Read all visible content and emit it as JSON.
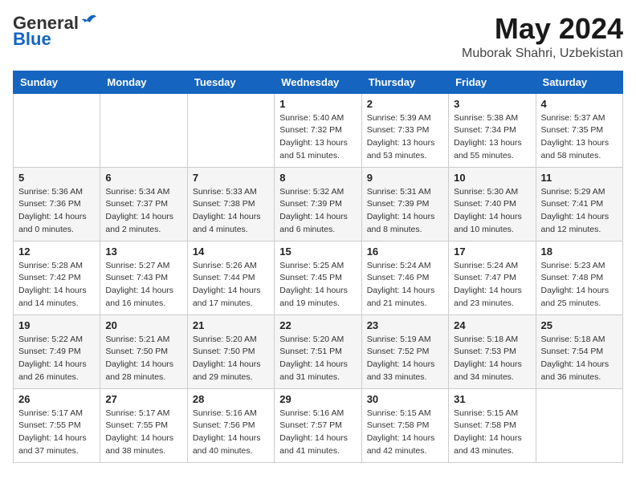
{
  "header": {
    "logo_general": "General",
    "logo_blue": "Blue",
    "month": "May 2024",
    "location": "Muborak Shahri, Uzbekistan"
  },
  "days_of_week": [
    "Sunday",
    "Monday",
    "Tuesday",
    "Wednesday",
    "Thursday",
    "Friday",
    "Saturday"
  ],
  "weeks": [
    [
      {
        "day": "",
        "sunrise": "",
        "sunset": "",
        "daylight": ""
      },
      {
        "day": "",
        "sunrise": "",
        "sunset": "",
        "daylight": ""
      },
      {
        "day": "",
        "sunrise": "",
        "sunset": "",
        "daylight": ""
      },
      {
        "day": "1",
        "sunrise": "Sunrise: 5:40 AM",
        "sunset": "Sunset: 7:32 PM",
        "daylight": "Daylight: 13 hours and 51 minutes."
      },
      {
        "day": "2",
        "sunrise": "Sunrise: 5:39 AM",
        "sunset": "Sunset: 7:33 PM",
        "daylight": "Daylight: 13 hours and 53 minutes."
      },
      {
        "day": "3",
        "sunrise": "Sunrise: 5:38 AM",
        "sunset": "Sunset: 7:34 PM",
        "daylight": "Daylight: 13 hours and 55 minutes."
      },
      {
        "day": "4",
        "sunrise": "Sunrise: 5:37 AM",
        "sunset": "Sunset: 7:35 PM",
        "daylight": "Daylight: 13 hours and 58 minutes."
      }
    ],
    [
      {
        "day": "5",
        "sunrise": "Sunrise: 5:36 AM",
        "sunset": "Sunset: 7:36 PM",
        "daylight": "Daylight: 14 hours and 0 minutes."
      },
      {
        "day": "6",
        "sunrise": "Sunrise: 5:34 AM",
        "sunset": "Sunset: 7:37 PM",
        "daylight": "Daylight: 14 hours and 2 minutes."
      },
      {
        "day": "7",
        "sunrise": "Sunrise: 5:33 AM",
        "sunset": "Sunset: 7:38 PM",
        "daylight": "Daylight: 14 hours and 4 minutes."
      },
      {
        "day": "8",
        "sunrise": "Sunrise: 5:32 AM",
        "sunset": "Sunset: 7:39 PM",
        "daylight": "Daylight: 14 hours and 6 minutes."
      },
      {
        "day": "9",
        "sunrise": "Sunrise: 5:31 AM",
        "sunset": "Sunset: 7:39 PM",
        "daylight": "Daylight: 14 hours and 8 minutes."
      },
      {
        "day": "10",
        "sunrise": "Sunrise: 5:30 AM",
        "sunset": "Sunset: 7:40 PM",
        "daylight": "Daylight: 14 hours and 10 minutes."
      },
      {
        "day": "11",
        "sunrise": "Sunrise: 5:29 AM",
        "sunset": "Sunset: 7:41 PM",
        "daylight": "Daylight: 14 hours and 12 minutes."
      }
    ],
    [
      {
        "day": "12",
        "sunrise": "Sunrise: 5:28 AM",
        "sunset": "Sunset: 7:42 PM",
        "daylight": "Daylight: 14 hours and 14 minutes."
      },
      {
        "day": "13",
        "sunrise": "Sunrise: 5:27 AM",
        "sunset": "Sunset: 7:43 PM",
        "daylight": "Daylight: 14 hours and 16 minutes."
      },
      {
        "day": "14",
        "sunrise": "Sunrise: 5:26 AM",
        "sunset": "Sunset: 7:44 PM",
        "daylight": "Daylight: 14 hours and 17 minutes."
      },
      {
        "day": "15",
        "sunrise": "Sunrise: 5:25 AM",
        "sunset": "Sunset: 7:45 PM",
        "daylight": "Daylight: 14 hours and 19 minutes."
      },
      {
        "day": "16",
        "sunrise": "Sunrise: 5:24 AM",
        "sunset": "Sunset: 7:46 PM",
        "daylight": "Daylight: 14 hours and 21 minutes."
      },
      {
        "day": "17",
        "sunrise": "Sunrise: 5:24 AM",
        "sunset": "Sunset: 7:47 PM",
        "daylight": "Daylight: 14 hours and 23 minutes."
      },
      {
        "day": "18",
        "sunrise": "Sunrise: 5:23 AM",
        "sunset": "Sunset: 7:48 PM",
        "daylight": "Daylight: 14 hours and 25 minutes."
      }
    ],
    [
      {
        "day": "19",
        "sunrise": "Sunrise: 5:22 AM",
        "sunset": "Sunset: 7:49 PM",
        "daylight": "Daylight: 14 hours and 26 minutes."
      },
      {
        "day": "20",
        "sunrise": "Sunrise: 5:21 AM",
        "sunset": "Sunset: 7:50 PM",
        "daylight": "Daylight: 14 hours and 28 minutes."
      },
      {
        "day": "21",
        "sunrise": "Sunrise: 5:20 AM",
        "sunset": "Sunset: 7:50 PM",
        "daylight": "Daylight: 14 hours and 29 minutes."
      },
      {
        "day": "22",
        "sunrise": "Sunrise: 5:20 AM",
        "sunset": "Sunset: 7:51 PM",
        "daylight": "Daylight: 14 hours and 31 minutes."
      },
      {
        "day": "23",
        "sunrise": "Sunrise: 5:19 AM",
        "sunset": "Sunset: 7:52 PM",
        "daylight": "Daylight: 14 hours and 33 minutes."
      },
      {
        "day": "24",
        "sunrise": "Sunrise: 5:18 AM",
        "sunset": "Sunset: 7:53 PM",
        "daylight": "Daylight: 14 hours and 34 minutes."
      },
      {
        "day": "25",
        "sunrise": "Sunrise: 5:18 AM",
        "sunset": "Sunset: 7:54 PM",
        "daylight": "Daylight: 14 hours and 36 minutes."
      }
    ],
    [
      {
        "day": "26",
        "sunrise": "Sunrise: 5:17 AM",
        "sunset": "Sunset: 7:55 PM",
        "daylight": "Daylight: 14 hours and 37 minutes."
      },
      {
        "day": "27",
        "sunrise": "Sunrise: 5:17 AM",
        "sunset": "Sunset: 7:55 PM",
        "daylight": "Daylight: 14 hours and 38 minutes."
      },
      {
        "day": "28",
        "sunrise": "Sunrise: 5:16 AM",
        "sunset": "Sunset: 7:56 PM",
        "daylight": "Daylight: 14 hours and 40 minutes."
      },
      {
        "day": "29",
        "sunrise": "Sunrise: 5:16 AM",
        "sunset": "Sunset: 7:57 PM",
        "daylight": "Daylight: 14 hours and 41 minutes."
      },
      {
        "day": "30",
        "sunrise": "Sunrise: 5:15 AM",
        "sunset": "Sunset: 7:58 PM",
        "daylight": "Daylight: 14 hours and 42 minutes."
      },
      {
        "day": "31",
        "sunrise": "Sunrise: 5:15 AM",
        "sunset": "Sunset: 7:58 PM",
        "daylight": "Daylight: 14 hours and 43 minutes."
      },
      {
        "day": "",
        "sunrise": "",
        "sunset": "",
        "daylight": ""
      }
    ]
  ]
}
